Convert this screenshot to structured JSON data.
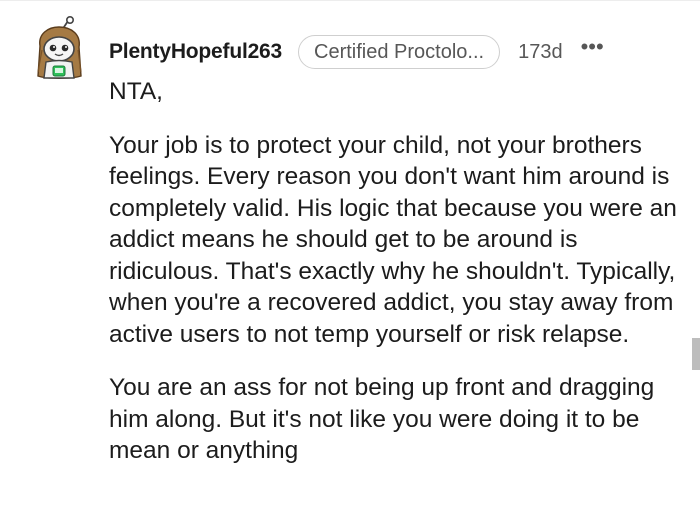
{
  "comment": {
    "author": "PlentyHopeful263",
    "flair": "Certified Proctolo...",
    "age": "173d",
    "more_label": "•••",
    "body": {
      "opening": "NTA,",
      "paragraph_1": "Your job is to protect your child, not your brothers feelings. Every reason you don't want him around is completely valid. His logic that because you were an addict means he should get to be around is ridiculous. That's exactly why he shouldn't. Typically, when you're a recovered addict, you stay away from active users to not temp yourself or risk relapse.",
      "paragraph_2": "You are an ass for not being up front and dragging him along. But it's not like you were doing it to be mean or anything"
    }
  },
  "icons": {
    "avatar": "snoo-avatar-icon",
    "more": "more-options-icon"
  },
  "colors": {
    "text": "#1c1c1c",
    "meta": "#575757",
    "flair_border": "#cfcfcf",
    "scrollbar": "#bdbdbd"
  }
}
